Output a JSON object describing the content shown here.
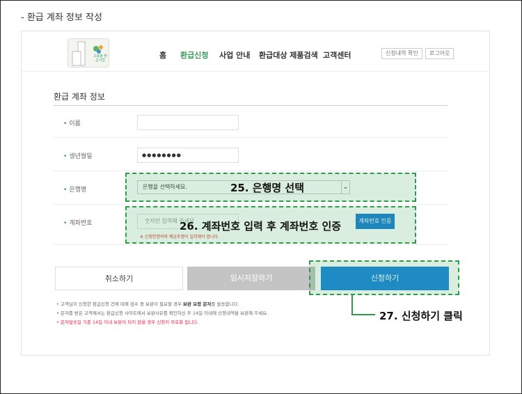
{
  "section_heading": "- 환급 계좌 정보 작성",
  "nav": {
    "logo_caption": "고효율 환급사업",
    "items": [
      {
        "label": "홈",
        "active": false
      },
      {
        "label": "환급신청",
        "active": true
      },
      {
        "label": "사업 안내",
        "active": false
      },
      {
        "label": "환급대상 제품검색",
        "active": false
      },
      {
        "label": "고객센터",
        "active": false
      }
    ],
    "history_button": "신청내역 확인",
    "logout_button": "로그아웃"
  },
  "form": {
    "title": "환급 계좌 정보",
    "name_label": "이름",
    "name_value": "",
    "birth_label": "생년월일",
    "birth_value": "●●●●●●●●",
    "bank_label": "은행명",
    "bank_placeholder": "은행을 선택하세요.",
    "bank_arrow": "⌄",
    "account_label": "계좌번호",
    "account_placeholder": "숫자만 입력해 주세요",
    "verify_button": "계좌번호 인증",
    "warning": "※ 신청인명의와 예금주명이 일치해야 합니다."
  },
  "buttons": {
    "cancel": "취소하기",
    "temp_save": "임시저장하기",
    "apply": "신청하기"
  },
  "notes": {
    "line1_prefix": "• 고객님이 신청한 환급신청 건에 대해 검수 중 보완이 필요할 경우 ",
    "line1_bold": "보완 요청 문자",
    "line1_suffix": "를 발송합니다.",
    "line2": "• 문자를 받은 고객께서는 환급신청 사이트에서 보완사유를 확인하신 후 14일 이내에 신청내역을 보완해 주세요.",
    "line3": "• 문자발송일 기준 14일 이내 보완이 되지 않을 경우 신청이 무효화 됩니다."
  },
  "callouts": {
    "step25": "25. 은행명 선택",
    "step26": "26. 계좌번호 입력 후 계좌번호 인증",
    "step27": "27. 신청하기 클릭"
  },
  "colors": {
    "accent_green": "#3a9a5c",
    "apply_blue": "#1d87de",
    "highlight_green": "#2f9a4a"
  }
}
